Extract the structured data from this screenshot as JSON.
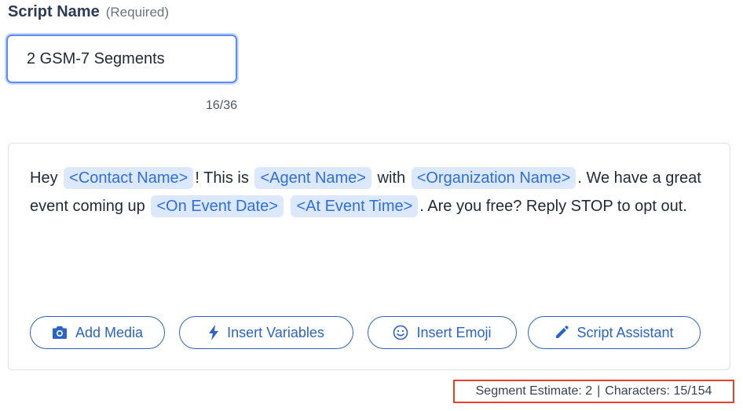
{
  "field": {
    "label": "Script Name",
    "required_hint": "(Required)",
    "value": "2 GSM-7 Segments",
    "char_count": "16/36"
  },
  "message": {
    "t1": "Hey",
    "v1": "<Contact Name>",
    "t2": "! This is",
    "v2": "<Agent Name>",
    "t3": "with",
    "v3": "<Organization Name>",
    "t4": ". We have a great event coming up",
    "v4": "<On Event Date>",
    "v5": "<At Event Time>",
    "t5": ". Are you free? Reply STOP to opt out."
  },
  "toolbar": {
    "add_media": "Add Media",
    "insert_variables": "Insert Variables",
    "insert_emoji": "Insert Emoji",
    "script_assistant": "Script Assistant"
  },
  "stats": {
    "segment": "Segment Estimate: 2",
    "separator": "|",
    "characters": "Characters: 15/154"
  },
  "colors": {
    "accent": "#2b63c6",
    "chip_bg": "#dce8fd",
    "highlight_box": "#e8412c"
  }
}
